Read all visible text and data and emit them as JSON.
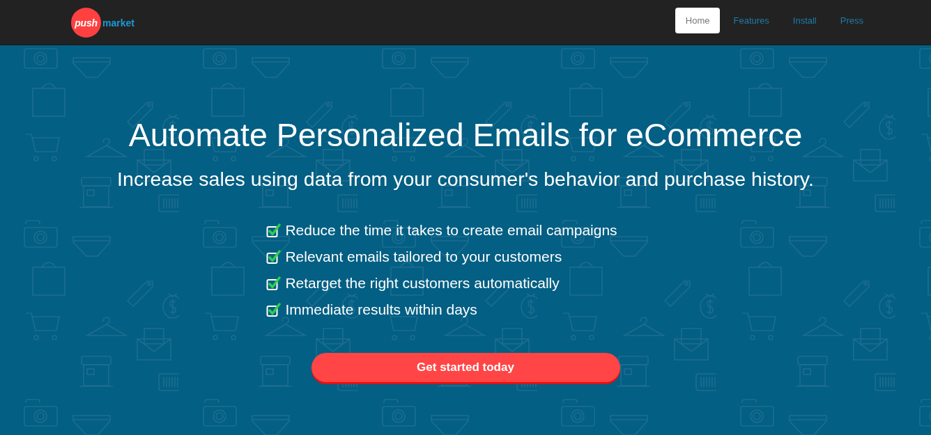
{
  "navbar": {
    "logo": {
      "badge": "push",
      "wordmark": "market"
    },
    "links": [
      {
        "label": "Home",
        "selected": true
      },
      {
        "label": "Features",
        "selected": false
      },
      {
        "label": "Install",
        "selected": false
      },
      {
        "label": "Press",
        "selected": false
      }
    ]
  },
  "hero": {
    "title": "Automate Personalized Emails for eCommerce",
    "subtitle": "Increase sales using data from your consumer's behavior and purchase history.",
    "benefits": [
      {
        "text": "Reduce the time it takes to create email campaigns",
        "checked": true
      },
      {
        "text": "Relevant emails tailored to your customers",
        "checked": true
      },
      {
        "text": "Retarget the right customers automatically",
        "checked": true
      },
      {
        "text": "Immediate results within days",
        "checked": true
      }
    ],
    "cta": "Get started today"
  }
}
